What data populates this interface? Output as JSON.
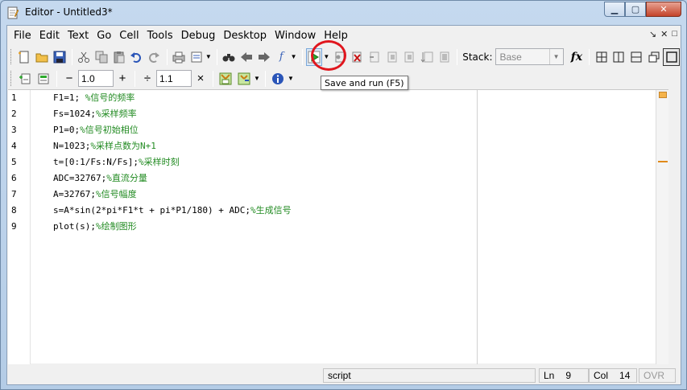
{
  "window": {
    "title": "Editor - Untitled3*"
  },
  "menu": [
    "File",
    "Edit",
    "Text",
    "Go",
    "Cell",
    "Tools",
    "Debug",
    "Desktop",
    "Window",
    "Help"
  ],
  "menu_controls": {
    "undock": "↘",
    "close": "✕",
    "maximize": "□"
  },
  "toolbar": {
    "stack_label": "Stack:",
    "stack_value": "Base",
    "fx_label": "fx"
  },
  "cell_toolbar": {
    "minus": "−",
    "value1": "1.0",
    "plus": "+",
    "divide": "÷",
    "value2": "1.1",
    "times": "×"
  },
  "tooltip": "Save and run (F5)",
  "editor": {
    "lines": [
      {
        "n": "1",
        "code": "F1=1; ",
        "comment": "%信号的频率"
      },
      {
        "n": "2",
        "code": "Fs=1024;",
        "comment": "%采样频率"
      },
      {
        "n": "3",
        "code": "P1=0;",
        "comment": "%信号初始相位"
      },
      {
        "n": "4",
        "code": "N=1023;",
        "comment": "%采样点数为N+1"
      },
      {
        "n": "5",
        "code": "t=[0:1/Fs:N/Fs];",
        "comment": "%采样时刻"
      },
      {
        "n": "6",
        "code": "ADC=32767;",
        "comment": "%直流分量"
      },
      {
        "n": "7",
        "code": "A=32767;",
        "comment": "%信号幅度"
      },
      {
        "n": "8",
        "code": "s=A*sin(2*pi*F1*t + pi*P1/180) + ADC;",
        "comment": "%生成信号"
      },
      {
        "n": "9",
        "code": "plot(s);",
        "comment": "%绘制图形"
      }
    ]
  },
  "status": {
    "mode": "script",
    "ln_label": "Ln",
    "ln_value": "9",
    "col_label": "Col",
    "col_value": "14",
    "ovr": "OVR"
  },
  "colors": {
    "comment": "#228b22",
    "highlight": "#e0161e",
    "run_green": "#2eaa2e"
  }
}
